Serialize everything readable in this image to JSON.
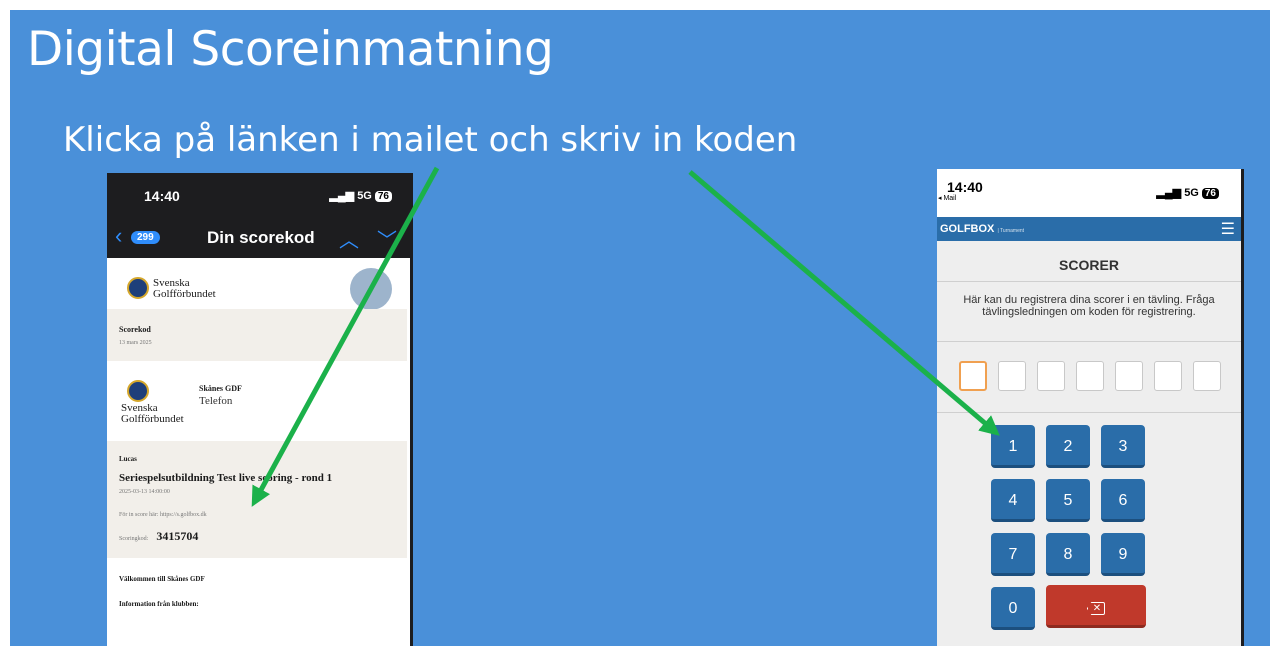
{
  "slide": {
    "title": "Digital Scoreinmatning",
    "subtitle": "Klicka på länken i mailet och skriv in koden"
  },
  "left_phone": {
    "status_time": "14:40",
    "status_signal": "5G",
    "status_battery": "76",
    "back_count": "299",
    "nav_title": "Din scorekod",
    "logo_text_1": "Svenska",
    "logo_text_2": "Golfförbundet",
    "section_title": "Scorekod",
    "section_date": "13 mars 2025",
    "sender_name": "Skånes GDF",
    "sender_phone": "Telefon",
    "player": "Lucas",
    "event": "Seriespelsutbildning Test live scoring - rond 1",
    "event_time": "2025-03-13 14:00:00",
    "link_text": "För in score här: https://s.golfbox.dk",
    "code_label": "Scoringkod:",
    "code_value": "3415704",
    "welcome": "Välkommen till Skånes GDF",
    "club_info": "Information från klubben:"
  },
  "right_phone": {
    "status_time": "14:40",
    "back_label": "◂ Mail",
    "status_signal": "5G",
    "status_battery": "76",
    "brand": "GOLFBOX",
    "brand_sub": "| Turnament",
    "page_title": "SCORER",
    "description": "Här kan du registrera dina scorer i en tävling. Fråga tävlingsledningen om koden för registrering.",
    "code_boxes": 7,
    "keys": [
      "1",
      "2",
      "3",
      "4",
      "5",
      "6",
      "7",
      "8",
      "9",
      "0"
    ]
  },
  "colors": {
    "slide_bg": "#4a90d9",
    "arrow": "#1bb14a",
    "keypad": "#2a6da9",
    "delete": "#c0392b"
  },
  "icons": [
    "back-chevron-icon",
    "up-chevron-icon",
    "down-chevron-icon",
    "menu-icon",
    "backspace-icon",
    "emblem-icon"
  ]
}
